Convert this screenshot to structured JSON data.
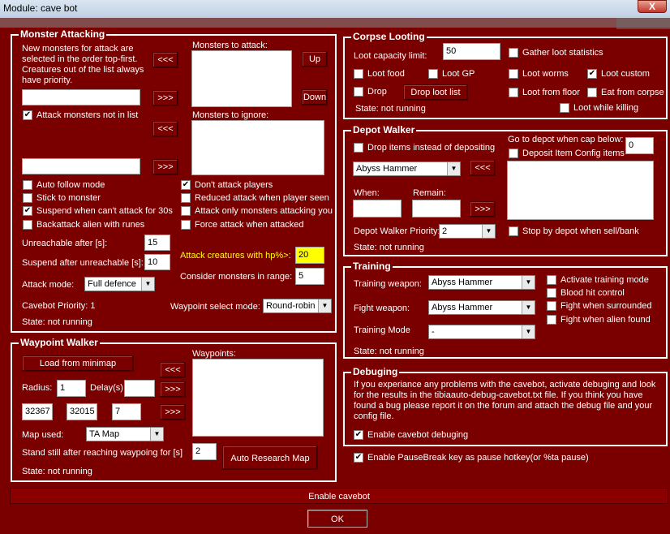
{
  "window": {
    "title": "Module: cave bot",
    "close": "X"
  },
  "monster_attacking": {
    "title": "Monster Attacking",
    "desc": [
      "New monsters for attack are",
      "selected in the order top-first.",
      "Creatures out of the list always",
      "have priority."
    ],
    "to_attack_label": "Monsters to attack:",
    "to_ignore_label": "Monsters to ignore:",
    "up": "Up",
    "down": "Down",
    "move_left": "<<<",
    "move_right": ">>>",
    "attack_not_in_list": "Attack monsters not in list",
    "auto_follow": "Auto follow mode",
    "stick": "Stick to monster",
    "suspend_cant_attack": "Suspend when can't attack for 30s",
    "backattack": "Backattack alien with runes",
    "dont_attack_players": "Don't attack players",
    "reduced_attack": "Reduced attack when player seen",
    "attack_only_attacking": "Attack only monsters attacking you",
    "force_attack": "Force attack when attacked",
    "unreachable_label": "Unreachable after [s]:",
    "unreachable_val": "15",
    "suspend_unreachable_label": "Suspend after unreachable [s]:",
    "suspend_unreachable_val": "10",
    "hp_label": "Attack creatures with hp%>:",
    "hp_val": "20",
    "range_label": "Consider monsters in range:",
    "range_val": "5",
    "mode_label": "Attack mode:",
    "mode_val": "Full defence",
    "priority": "Cavebot Priority: 1",
    "wp_mode_label": "Waypoint select mode:",
    "wp_mode_val": "Round-robin",
    "state": "State: not running"
  },
  "corpse": {
    "title": "Corpse Looting",
    "capacity_label": "Loot capacity limit:",
    "capacity_val": "50",
    "gather": "Gather loot statistics",
    "loot_food": "Loot food",
    "loot_gp": "Loot GP",
    "loot_worms": "Loot worms",
    "loot_custom": "Loot custom",
    "drop": "Drop",
    "drop_list": "Drop loot list",
    "loot_floor": "Loot from floor",
    "eat_corpse": "Eat from corpse",
    "state": "State: not running",
    "loot_killing": "Loot while killing"
  },
  "depot": {
    "title": "Depot Walker",
    "drop_items": "Drop items instead of depositing",
    "goto_label": "Go to depot when cap below:",
    "goto_val": "0",
    "config": "Deposit Item Config items",
    "item_val": "Abyss Hammer",
    "move": "<<<",
    "move2": ">>>",
    "when": "When:",
    "remain": "Remain:",
    "priority_label": "Depot Walker Priority:",
    "priority_val": "2",
    "stop_depot": "Stop by depot when sell/bank",
    "state": "State: not running"
  },
  "training": {
    "title": "Training",
    "training_weapon_label": "Training weapon:",
    "training_weapon_val": "Abyss Hammer",
    "fight_weapon_label": "Fight weapon:",
    "fight_weapon_val": "Abyss Hammer",
    "mode_label": "Training Mode",
    "mode_val": "-",
    "activate": "Activate training mode",
    "blood": "Blood hit control",
    "fight_surrounded": "Fight when surrounded",
    "fight_alien": "Fight when alien found",
    "state": "State: not running"
  },
  "waypoint": {
    "title": "Waypoint Walker",
    "load": "Load from minimap",
    "waypoints_label": "Waypoints:",
    "radius_label": "Radius:",
    "radius_val": "1",
    "delay_label": "Delay(s)",
    "delay_val": "",
    "x": "32367",
    "y": "32015",
    "z": "7",
    "map_label": "Map used:",
    "map_val": "TA Map",
    "standstill_label": "Stand still after reaching waypoing for [s]",
    "standstill_val": "2",
    "research": "Auto Research Map",
    "state": "State: not running",
    "b1": "<<<",
    "b2": ">>>",
    "b3": ">>>"
  },
  "debug": {
    "title": "Debuging",
    "text": [
      "If you experiance any problems with the cavebot, activate debuging and look",
      "for the results in the tibiaauto-debug-cavebot.txt file. If you think you have",
      "found a bug please report it on the forum and attach the debug file and your",
      "config file."
    ],
    "enable": "Enable cavebot debuging"
  },
  "pausebreak": "Enable PauseBreak key as pause hotkey(or %ta pause)",
  "enable_cavebot": "Enable cavebot",
  "ok": "OK",
  "checks": {
    "check": "✔"
  }
}
